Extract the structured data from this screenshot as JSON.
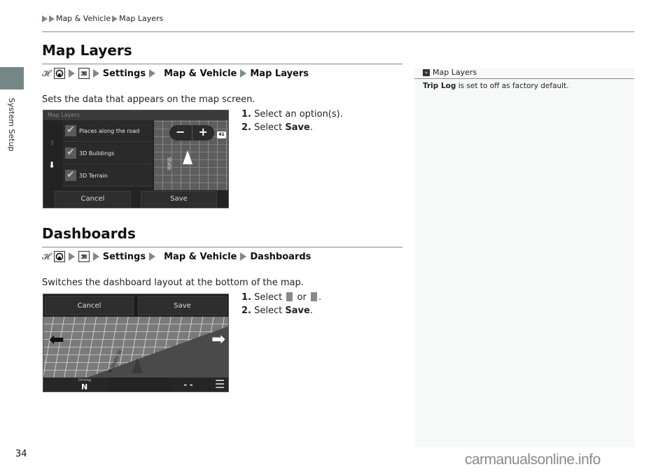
{
  "breadcrumb": [
    "Map & Vehicle",
    "Map Layers"
  ],
  "side_tab": {
    "label": "System Setup"
  },
  "sections": [
    {
      "title": "Map Layers",
      "path": [
        "Settings",
        "Map & Vehicle",
        "Map Layers"
      ],
      "description": "Sets the data that appears on the map screen.",
      "steps": [
        {
          "num": "1.",
          "text": "Select an option(s)."
        },
        {
          "num": "2.",
          "text_prefix": "Select ",
          "bold": "Save",
          "text_suffix": "."
        }
      ],
      "screen": {
        "header": "Map Layers",
        "options": [
          {
            "label": "Places along the road",
            "checked": true
          },
          {
            "label": "3D Buildings",
            "checked": true
          },
          {
            "label": "3D Terrain",
            "checked": true
          }
        ],
        "zoom_out": "−",
        "zoom_in": "+",
        "route_shield": "41",
        "street_name": "State",
        "cancel": "Cancel",
        "save": "Save"
      }
    },
    {
      "title": "Dashboards",
      "path": [
        "Settings",
        "Map & Vehicle",
        "Dashboards"
      ],
      "description": "Switches the dashboard layout at the bottom of the map.",
      "steps": [
        {
          "num": "1.",
          "text_prefix": "Select ",
          "mid": " or ",
          "text_suffix": "."
        },
        {
          "num": "2.",
          "text_prefix": "Select ",
          "bold": "Save",
          "text_suffix": "."
        }
      ],
      "screen": {
        "cancel": "Cancel",
        "save": "Save",
        "street_name": "N State St",
        "dash_label": "Driving",
        "dash_value": "N",
        "dash_mid": "- -"
      }
    }
  ],
  "note": {
    "title": "Map Layers",
    "bold": "Trip Log",
    "text": " is set to off as factory default."
  },
  "page_number": "34",
  "watermark": "carmanualsonline.info"
}
